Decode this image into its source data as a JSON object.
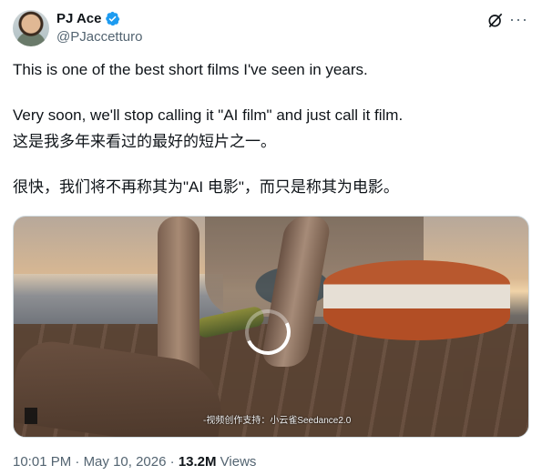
{
  "author": {
    "display_name": "PJ Ace",
    "handle": "@PJaccetturo",
    "verified_icon": "verified-badge-icon"
  },
  "actions": {
    "grok_icon": "grok-icon",
    "more": "···"
  },
  "tweet": {
    "line1": "This is one of the best short films I've seen in years.",
    "line2": "Very soon, we'll stop calling it \"AI film\" and just call it film.",
    "line3": "这是我多年来看过的最好的短片之一。",
    "line4": "很快，我们将不再称其为\"AI 电影\"，而只是称其为电影。"
  },
  "media": {
    "watermark": "-视频创作支持：小云雀Seedance2.0"
  },
  "meta": {
    "time": "10:01 PM",
    "sep1": " · ",
    "date": "May 10, 2026",
    "sep2": " · ",
    "views_count": "13.2M",
    "views_label": " Views"
  },
  "colors": {
    "verified": "#1d9bf0",
    "muted": "#536471",
    "text": "#0f1419"
  }
}
